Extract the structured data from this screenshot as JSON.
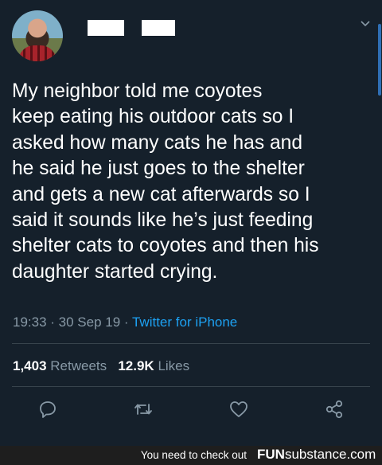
{
  "tweet": {
    "text": "My neighbor told me coyotes\nkeep eating his outdoor cats so I\nasked how many cats he has and\nhe said he just goes to the shelter\nand gets a new cat afterwards so I\nsaid it sounds like he’s just feeding\nshelter cats to coyotes and then his\ndaughter started crying.",
    "time": "19:33",
    "date": "30 Sep 19",
    "source": "Twitter for iPhone",
    "retweets_count": "1,403",
    "retweets_label": "Retweets",
    "likes_count": "12.9K",
    "likes_label": "Likes"
  },
  "icons": {
    "more": "chevron-down-icon",
    "reply": "reply-icon",
    "retweet": "retweet-icon",
    "like": "heart-icon",
    "share": "share-icon"
  },
  "banner": {
    "message": "You need to check out",
    "logo_bold": "FUN",
    "logo_rest": "substance.com"
  },
  "colors": {
    "background": "#15202b",
    "muted": "#8899a6",
    "accent": "#1da1f2",
    "divider": "#38444d"
  }
}
